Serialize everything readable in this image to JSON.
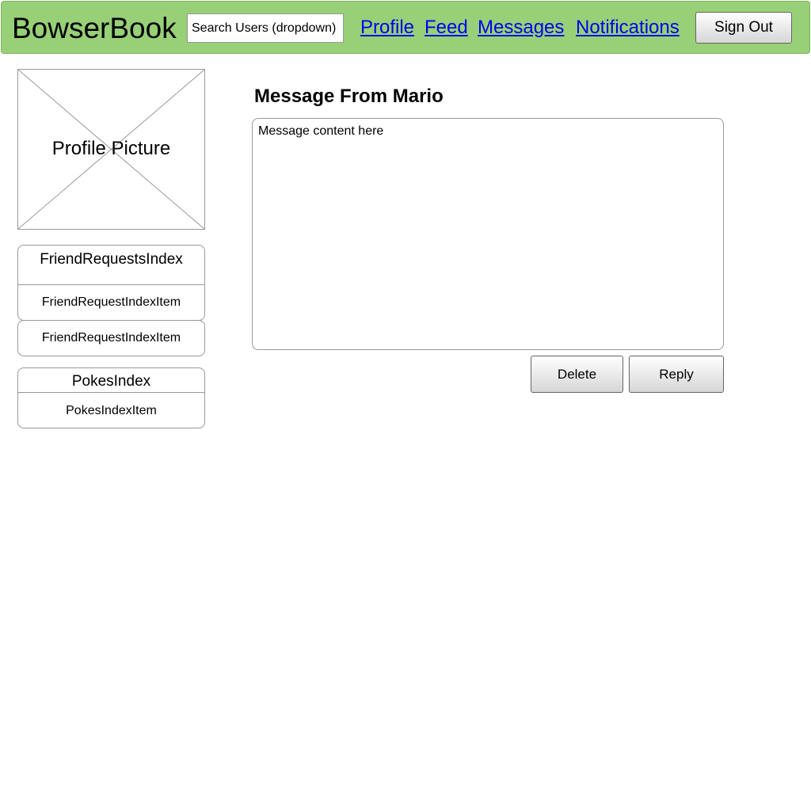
{
  "header": {
    "brand": "BowserBook",
    "search_placeholder": "Search Users (dropdown)",
    "nav": {
      "profile": "Profile",
      "feed": "Feed",
      "messages": "Messages",
      "notifications": "Notifications"
    },
    "sign_out_label": "Sign Out",
    "background_color": "#97d077"
  },
  "sidebar": {
    "profile_picture_label": "Profile Picture",
    "friend_requests": {
      "title": "FriendRequestsIndex",
      "items": [
        "FriendRequestIndexItem",
        "FriendRequestIndexItem"
      ]
    },
    "pokes": {
      "title": "PokesIndex",
      "items": [
        "PokesIndexItem"
      ]
    }
  },
  "main": {
    "title": "Message From Mario",
    "content": "Message content here",
    "delete_label": "Delete",
    "reply_label": "Reply"
  }
}
